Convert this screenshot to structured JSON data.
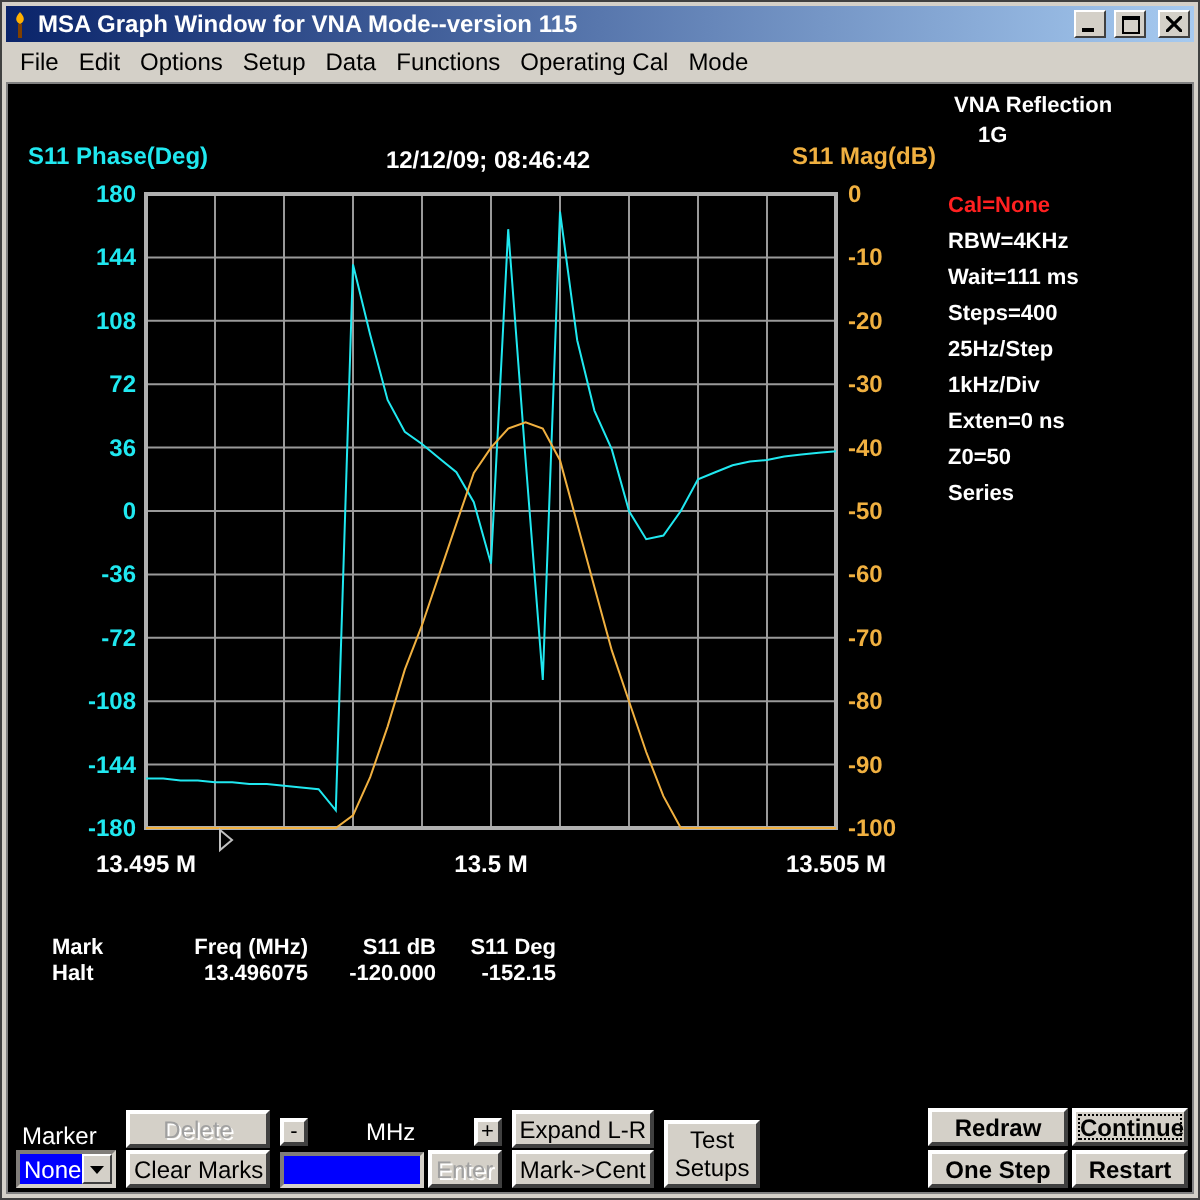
{
  "window": {
    "title": "MSA Graph Window for VNA Mode--version 115"
  },
  "menu": [
    "File",
    "Edit",
    "Options",
    "Setup",
    "Data",
    "Functions",
    "Operating Cal",
    "Mode"
  ],
  "graph": {
    "chart_data": {
      "type": "line",
      "title": "12/12/09; 08:46:42",
      "grid": true,
      "x": [
        13.495,
        13.49525,
        13.4955,
        13.49575,
        13.496,
        13.49625,
        13.4965,
        13.49675,
        13.497,
        13.49725,
        13.4975,
        13.49775,
        13.498,
        13.49825,
        13.4985,
        13.49875,
        13.499,
        13.49925,
        13.4995,
        13.49975,
        13.5,
        13.50025,
        13.5005,
        13.50075,
        13.501,
        13.50125,
        13.5015,
        13.50175,
        13.502,
        13.50225,
        13.5025,
        13.50275,
        13.503,
        13.50325,
        13.5035,
        13.50375,
        13.504,
        13.50425,
        13.5045,
        13.50475,
        13.505
      ],
      "series": [
        {
          "name": "S11 Phase(Deg)",
          "color": "#20e8f0",
          "values": [
            -152,
            -152,
            -153,
            -153,
            -154,
            -154,
            -155,
            -155,
            -156,
            -157,
            -158,
            -170,
            140,
            100,
            63,
            45,
            38,
            30,
            22,
            5,
            -30,
            160,
            29,
            -96,
            170,
            97,
            57,
            35,
            0,
            -16,
            -14,
            0,
            18,
            22,
            26,
            28,
            29,
            31,
            32,
            33,
            34
          ]
        },
        {
          "name": "S11 Mag(dB)",
          "color": "#f0b040",
          "axis": "y2",
          "values": [
            -100,
            -100,
            -100,
            -100,
            -100,
            -100,
            -100,
            -100,
            -100,
            -100,
            -100,
            -100,
            -98,
            -92,
            -84,
            -75,
            -68,
            -60,
            -52,
            -44,
            -40,
            -37,
            -36,
            -37,
            -42,
            -52,
            -62,
            -72,
            -80,
            -88,
            -95,
            -100,
            -100,
            -100,
            -100,
            -100,
            -100,
            -100,
            -100,
            -100,
            -100
          ]
        }
      ],
      "xlim": [
        13.495,
        13.505
      ],
      "ylim": [
        -180,
        180
      ],
      "y2lim": [
        -100,
        0
      ],
      "xticks": [
        {
          "value": 13.495,
          "label": "13.495 M"
        },
        {
          "value": 13.5,
          "label": "13.5 M"
        },
        {
          "value": 13.505,
          "label": "13.505 M"
        }
      ],
      "yticks": [
        180,
        144,
        108,
        72,
        36,
        0,
        -36,
        -72,
        -108,
        -144,
        -180
      ],
      "y2ticks": [
        0,
        -10,
        -20,
        -30,
        -40,
        -50,
        -60,
        -70,
        -80,
        -90,
        -100
      ]
    }
  },
  "info": [
    {
      "text": "VNA Reflection",
      "kind": "heading"
    },
    {
      "text": "1G",
      "kind": "sub"
    },
    {
      "text": "Cal=None",
      "kind": "alert"
    },
    {
      "text": "RBW=4KHz",
      "kind": "normal"
    },
    {
      "text": "Wait=111 ms",
      "kind": "normal"
    },
    {
      "text": "Steps=400",
      "kind": "normal"
    },
    {
      "text": "25Hz/Step",
      "kind": "normal"
    },
    {
      "text": "1kHz/Div",
      "kind": "normal"
    },
    {
      "text": "Exten=0 ns",
      "kind": "normal"
    },
    {
      "text": "Z0=50",
      "kind": "normal"
    },
    {
      "text": "Series",
      "kind": "normal"
    }
  ],
  "marker_table": {
    "columns": [
      "Mark",
      "Freq (MHz)",
      "S11 dB",
      "S11 Deg"
    ],
    "rows": [
      [
        "Halt",
        "13.496075",
        "-120.000",
        "-152.15"
      ]
    ]
  },
  "controls": {
    "marker_label": "Marker",
    "marker_select": "None",
    "mark_buttons": [
      {
        "label": "Delete",
        "disabled": true
      },
      {
        "label": "Clear Marks",
        "disabled": false
      }
    ],
    "minus": "-",
    "unit": "MHz",
    "plus": "+",
    "enter": {
      "label": "Enter",
      "disabled": true
    },
    "expand_buttons": [
      {
        "label": "Expand L-R",
        "disabled": false
      },
      {
        "label": "Mark->Cent",
        "disabled": false
      }
    ],
    "test_setups": "Test Setups",
    "run_buttons": [
      {
        "label": "Redraw",
        "focused": false
      },
      {
        "label": "Continue",
        "focused": true
      },
      {
        "label": "One Step",
        "focused": false
      },
      {
        "label": "Restart",
        "focused": false
      }
    ]
  }
}
